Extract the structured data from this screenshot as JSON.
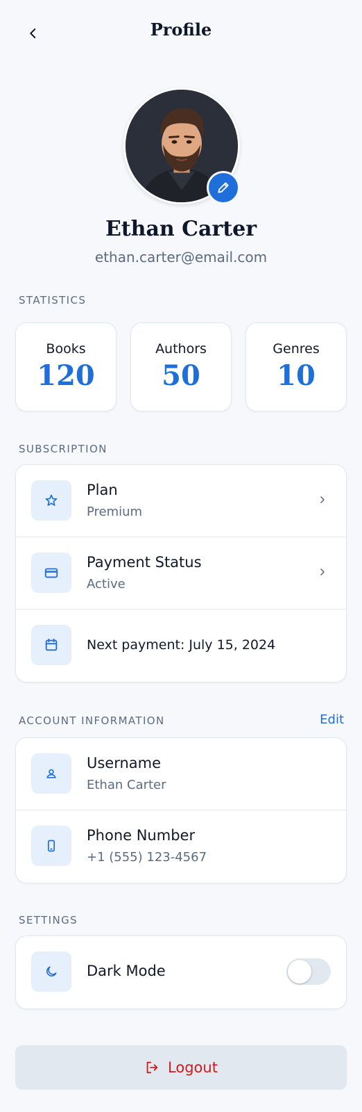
{
  "header": {
    "title": "Profile"
  },
  "profile": {
    "name": "Ethan Carter",
    "email": "ethan.carter@email.com"
  },
  "statistics": {
    "label": "STATISTICS",
    "items": [
      {
        "label": "Books",
        "value": "120"
      },
      {
        "label": "Authors",
        "value": "50"
      },
      {
        "label": "Genres",
        "value": "10"
      }
    ]
  },
  "subscription": {
    "label": "SUBSCRIPTION",
    "plan": {
      "title": "Plan",
      "value": "Premium",
      "icon": "star-icon"
    },
    "payment_status": {
      "title": "Payment Status",
      "value": "Active",
      "icon": "credit-card-icon"
    },
    "next_payment": {
      "text": "Next payment: July 15, 2024",
      "icon": "calendar-icon"
    }
  },
  "account": {
    "label": "ACCOUNT INFORMATION",
    "edit_label": "Edit",
    "username": {
      "title": "Username",
      "value": "Ethan Carter",
      "icon": "user-icon"
    },
    "phone": {
      "title": "Phone Number",
      "value": "+1 (555) 123-4567",
      "icon": "phone-icon"
    }
  },
  "settings": {
    "label": "SETTINGS",
    "dark_mode": {
      "title": "Dark Mode",
      "enabled": false,
      "icon": "moon-icon"
    }
  },
  "logout": {
    "label": "Logout",
    "icon": "logout-icon"
  },
  "colors": {
    "accent": "#1e6fd9",
    "danger": "#d11a1a",
    "background": "#f6f8fb",
    "icon_bg": "#e6f0fd"
  }
}
